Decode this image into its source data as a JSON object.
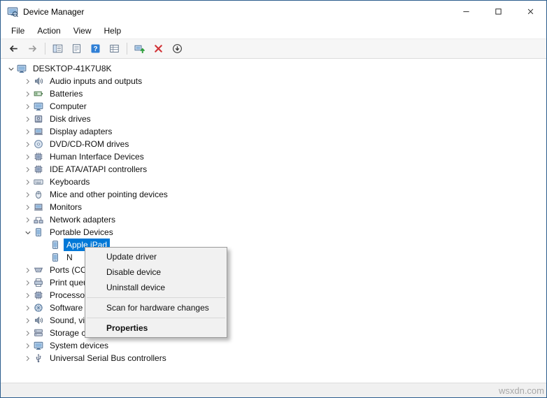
{
  "window": {
    "title": "Device Manager",
    "controls": [
      {
        "name": "minimize-button",
        "icon": "minimize-icon"
      },
      {
        "name": "maximize-button",
        "icon": "maximize-icon"
      },
      {
        "name": "close-button",
        "icon": "close-icon"
      }
    ]
  },
  "menu_bar": {
    "items": [
      "File",
      "Action",
      "View",
      "Help"
    ]
  },
  "toolbar": {
    "buttons": [
      {
        "name": "back-button",
        "icon": "arrow-left-icon"
      },
      {
        "name": "forward-button",
        "icon": "arrow-right-icon"
      },
      {
        "type": "separator"
      },
      {
        "name": "show-console-tree-button",
        "icon": "console-tree-icon"
      },
      {
        "name": "properties-button",
        "icon": "properties-icon"
      },
      {
        "name": "help-button",
        "icon": "help-icon"
      },
      {
        "name": "export-list-button",
        "icon": "export-list-icon"
      },
      {
        "type": "separator"
      },
      {
        "name": "update-driver-button",
        "icon": "update-driver-icon"
      },
      {
        "name": "uninstall-device-button",
        "icon": "uninstall-icon"
      },
      {
        "name": "scan-hardware-changes-button",
        "icon": "scan-hardware-icon"
      }
    ]
  },
  "tree": {
    "rows": [
      {
        "label": "DESKTOP-41K7U8K",
        "level": 0,
        "expand": "expanded",
        "icon": "computer-icon"
      },
      {
        "label": "Audio inputs and outputs",
        "level": 1,
        "expand": "collapsed",
        "icon": "speaker-icon"
      },
      {
        "label": "Batteries",
        "level": 1,
        "expand": "collapsed",
        "icon": "battery-icon"
      },
      {
        "label": "Computer",
        "level": 1,
        "expand": "collapsed",
        "icon": "computer-icon"
      },
      {
        "label": "Disk drives",
        "level": 1,
        "expand": "collapsed",
        "icon": "disk-drive-icon"
      },
      {
        "label": "Display adapters",
        "level": 1,
        "expand": "collapsed",
        "icon": "display-adapter-icon"
      },
      {
        "label": "DVD/CD-ROM drives",
        "level": 1,
        "expand": "collapsed",
        "icon": "cd-rom-icon"
      },
      {
        "label": "Human Interface Devices",
        "level": 1,
        "expand": "collapsed",
        "icon": "hid-icon"
      },
      {
        "label": "IDE ATA/ATAPI controllers",
        "level": 1,
        "expand": "collapsed",
        "icon": "ide-controller-icon"
      },
      {
        "label": "Keyboards",
        "level": 1,
        "expand": "collapsed",
        "icon": "keyboard-icon"
      },
      {
        "label": "Mice and other pointing devices",
        "level": 1,
        "expand": "collapsed",
        "icon": "mouse-icon"
      },
      {
        "label": "Monitors",
        "level": 1,
        "expand": "collapsed",
        "icon": "monitor-icon"
      },
      {
        "label": "Network adapters",
        "level": 1,
        "expand": "collapsed",
        "icon": "network-adapter-icon"
      },
      {
        "label": "Portable Devices",
        "level": 1,
        "expand": "expanded",
        "icon": "portable-device-icon"
      },
      {
        "label": "Apple iPad",
        "level": 2,
        "expand": "none",
        "icon": "portable-device-icon",
        "selected": true
      },
      {
        "label": "N",
        "level": 2,
        "expand": "none",
        "icon": "portable-device-icon"
      },
      {
        "label": "Ports (COM & LPT)",
        "level": 1,
        "expand": "collapsed",
        "icon": "serial-port-icon"
      },
      {
        "label": "Print queues",
        "level": 1,
        "expand": "collapsed",
        "icon": "printer-icon"
      },
      {
        "label": "Processors",
        "level": 1,
        "expand": "collapsed",
        "icon": "processor-icon"
      },
      {
        "label": "Software devices",
        "level": 1,
        "expand": "collapsed",
        "icon": "software-device-icon"
      },
      {
        "label": "Sound, video and game controllers",
        "level": 1,
        "expand": "collapsed",
        "icon": "sound-controller-icon"
      },
      {
        "label": "Storage controllers",
        "level": 1,
        "expand": "collapsed",
        "icon": "storage-controller-icon"
      },
      {
        "label": "System devices",
        "level": 1,
        "expand": "collapsed",
        "icon": "system-device-icon"
      },
      {
        "label": "Universal Serial Bus controllers",
        "level": 1,
        "expand": "collapsed",
        "icon": "usb-icon"
      }
    ]
  },
  "context_menu": {
    "items": [
      {
        "type": "item",
        "label": "Update driver"
      },
      {
        "type": "item",
        "label": "Disable device"
      },
      {
        "type": "item",
        "label": "Uninstall device"
      },
      {
        "type": "separator"
      },
      {
        "type": "item",
        "label": "Scan for hardware changes"
      },
      {
        "type": "separator"
      },
      {
        "type": "item",
        "label": "Properties",
        "bold": true
      }
    ]
  },
  "watermark": "wsxdn.com",
  "colors": {
    "selection": "#0078d7",
    "help_blue": "#2f7fd6",
    "update_green": "#2d9e3a",
    "uninstall_red": "#d13438"
  }
}
